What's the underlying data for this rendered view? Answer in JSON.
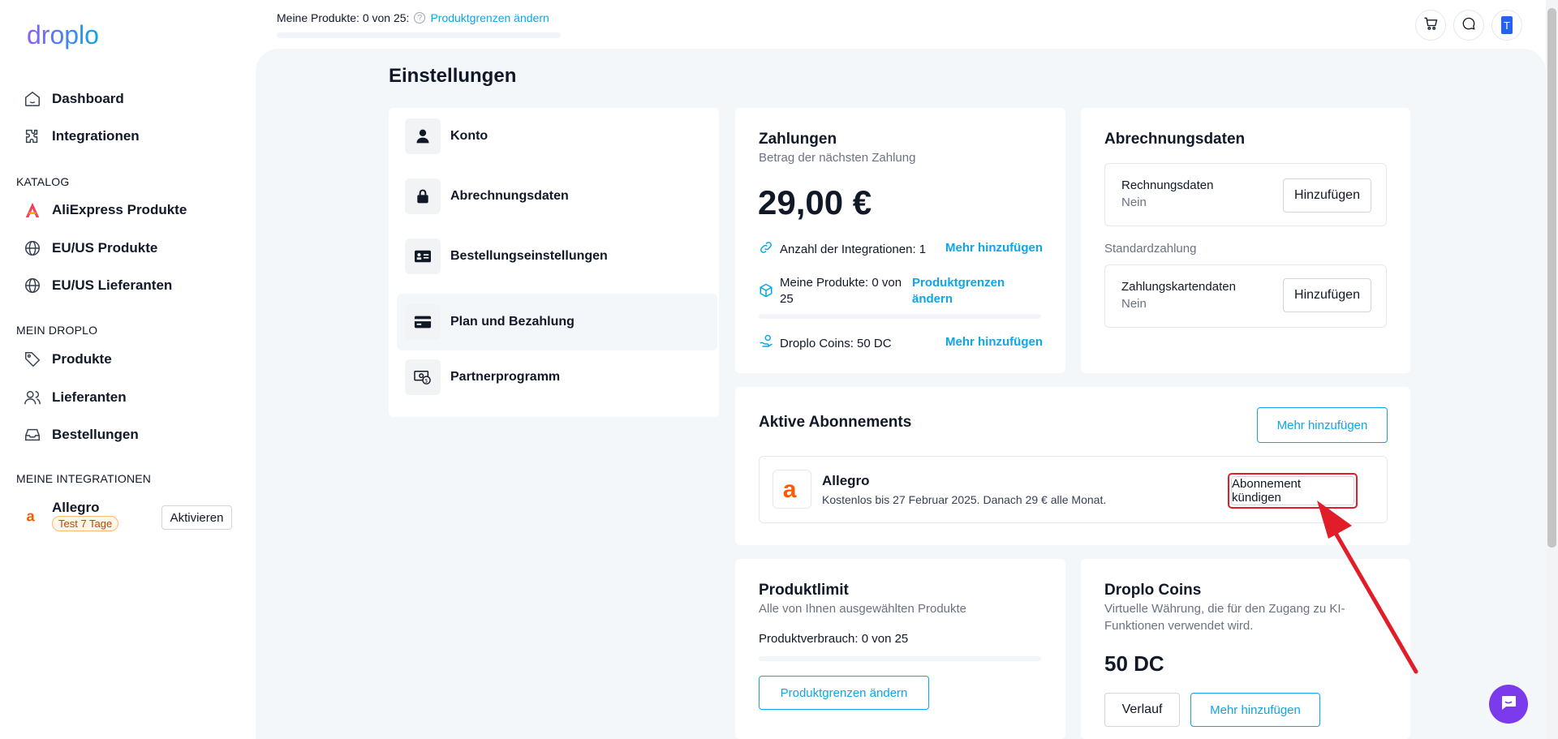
{
  "brand": {
    "logo_text": "droplo",
    "accent": "#0ea5e9",
    "purple": "#7c3aed",
    "annotation_red": "#e11d2a"
  },
  "topbar": {
    "products_text": "Meine Produkte: 0 von 25:",
    "products_link": "Produktgrenzen ändern",
    "products_progress": 0.0,
    "icons": [
      "cart-icon",
      "chat-icon",
      "user-avatar-icon"
    ],
    "avatar_letter": "T"
  },
  "sidebar": {
    "nav": [
      {
        "label": "Dashboard",
        "icon": "home-icon"
      },
      {
        "label": "Integrationen",
        "icon": "puzzle-icon"
      }
    ],
    "catalog_title": "KATALOG",
    "catalog": [
      {
        "label": "AliExpress Produkte",
        "icon": "aliexpress-icon"
      },
      {
        "label": "EU/US Produkte",
        "icon": "globe-icon"
      },
      {
        "label": "EU/US Lieferanten",
        "icon": "globe-icon"
      }
    ],
    "mine_title": "MEIN DROPLO",
    "mine": [
      {
        "label": "Produkte",
        "icon": "tag-icon"
      },
      {
        "label": "Lieferanten",
        "icon": "users-icon"
      },
      {
        "label": "Bestellungen",
        "icon": "inbox-icon"
      }
    ],
    "integrations_title": "MEINE INTEGRATIONEN",
    "integration": {
      "name": "Allegro",
      "badge": "Test 7 Tage",
      "button": "Aktivieren"
    }
  },
  "page": {
    "title": "Einstellungen"
  },
  "settings_menu": [
    {
      "label": "Konto",
      "icon": "person-icon",
      "active": false
    },
    {
      "label": "Abrechnungsdaten",
      "icon": "lock-icon",
      "active": false
    },
    {
      "label": "Bestellungseinstellungen",
      "icon": "id-card-icon",
      "active": false
    },
    {
      "label": "Plan und Bezahlung",
      "icon": "credit-card-icon",
      "active": true
    },
    {
      "label": "Partnerprogramm",
      "icon": "money-icon",
      "active": false
    }
  ],
  "payments": {
    "title": "Zahlungen",
    "subtitle": "Betrag der nächsten Zahlung",
    "amount": "29,00 €",
    "integrations_text": "Anzahl der Integrationen: 1",
    "integrations_link": "Mehr hinzufügen",
    "products_text": "Meine Produkte: 0 von 25",
    "products_link": "Produktgrenzen ändern",
    "products_progress": 0.0,
    "coins_text": "Droplo Coins: 50 DC",
    "coins_link": "Mehr hinzufügen"
  },
  "billing": {
    "title": "Abrechnungsdaten",
    "invoice_label": "Rechnungsdaten",
    "invoice_value": "Nein",
    "invoice_button": "Hinzufügen",
    "standard_label": "Standardzahlung",
    "card_label": "Zahlungskartendaten",
    "card_value": "Nein",
    "card_button": "Hinzufügen"
  },
  "subscriptions": {
    "title": "Aktive Abonnements",
    "add_button": "Mehr hinzufügen",
    "item": {
      "name": "Allegro",
      "description": "Kostenlos bis 27 Februar 2025. Danach 29 € alle Monat.",
      "cancel_button": "Abonnement kündigen"
    }
  },
  "product_limit": {
    "title": "Produktlimit",
    "subtitle": "Alle von Ihnen ausgewählten Produkte",
    "usage_text": "Produktverbrauch: 0 von 25",
    "usage_progress": 0.0,
    "button": "Produktgrenzen ändern"
  },
  "coins": {
    "title": "Droplo Coins",
    "subtitle": "Virtuelle Währung, die für den Zugang zu KI-Funktionen verwendet wird.",
    "amount": "50 DC",
    "history_button": "Verlauf",
    "add_button": "Mehr hinzufügen"
  }
}
